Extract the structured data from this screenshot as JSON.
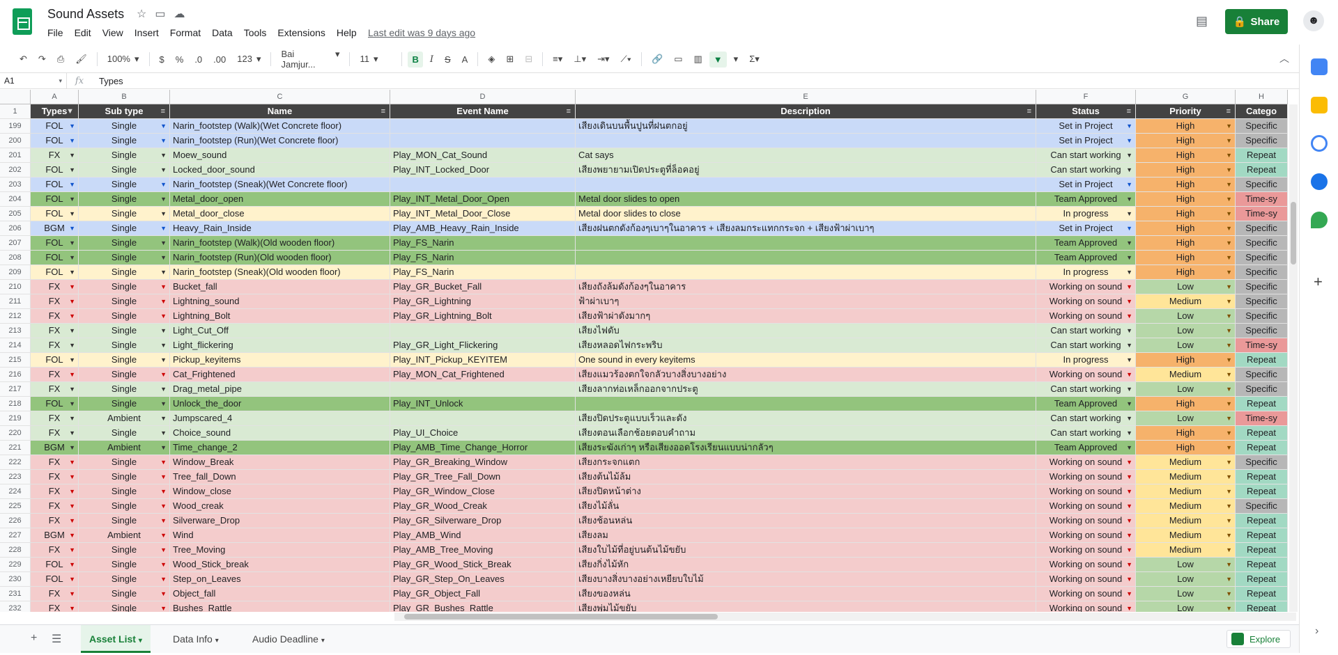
{
  "app": {
    "title": "Sound Assets",
    "menu": [
      "File",
      "Edit",
      "View",
      "Insert",
      "Format",
      "Data",
      "Tools",
      "Extensions",
      "Help"
    ],
    "last_edit": "Last edit was 9 days ago",
    "share_label": "Share"
  },
  "toolbar": {
    "zoom": "100%",
    "currency": "$",
    "percent": "%",
    "dec_less": ".0",
    "dec_more": ".00",
    "number_format": "123",
    "font": "Bai Jamjur...",
    "font_size": "11"
  },
  "formula_bar": {
    "cell_ref": "A1",
    "value": "Types"
  },
  "columns": [
    "A",
    "B",
    "C",
    "D",
    "E",
    "F",
    "G",
    "H"
  ],
  "headers": [
    "Types",
    "Sub type",
    "Name",
    "Event Name",
    "Description",
    "Status",
    "Priority",
    "Catego"
  ],
  "rows": [
    {
      "num": "199",
      "type": "FOL",
      "sub": "Single",
      "name": "Narin_footstep (Walk)(Wet Concrete floor)",
      "event": "",
      "desc": "เสียงเดินบนพื้นปูนที่ฝนตกอยู่",
      "status": "Set in Project",
      "priority": "High",
      "category": "Specific"
    },
    {
      "num": "200",
      "type": "FOL",
      "sub": "Single",
      "name": "Narin_footstep (Run)(Wet Concrete floor)",
      "event": "",
      "desc": "",
      "status": "Set in Project",
      "priority": "High",
      "category": "Specific"
    },
    {
      "num": "201",
      "type": "FX",
      "sub": "Single",
      "name": "Moew_sound",
      "event": "Play_MON_Cat_Sound",
      "desc": "Cat says",
      "status": "Can start working",
      "priority": "High",
      "category": "Repeat"
    },
    {
      "num": "202",
      "type": "FOL",
      "sub": "Single",
      "name": "Locked_door_sound",
      "event": "Play_INT_Locked_Door",
      "desc": "เสียงพยายามเปิดประตูที่ล็อคอยู่",
      "status": "Can start working",
      "priority": "High",
      "category": "Repeat"
    },
    {
      "num": "203",
      "type": "FOL",
      "sub": "Single",
      "name": "Narin_footstep (Sneak)(Wet Concrete floor)",
      "event": "",
      "desc": "",
      "status": "Set in Project",
      "priority": "High",
      "category": "Specific"
    },
    {
      "num": "204",
      "type": "FOL",
      "sub": "Single",
      "name": "Metal_door_open",
      "event": "Play_INT_Metal_Door_Open",
      "desc": "Metal door slides to open",
      "status": "Team Approved",
      "priority": "High",
      "category": "Time-sy"
    },
    {
      "num": "205",
      "type": "FOL",
      "sub": "Single",
      "name": "Metal_door_close",
      "event": "Play_INT_Metal_Door_Close",
      "desc": "Metal door slides to close",
      "status": "In progress",
      "priority": "High",
      "category": "Time-sy"
    },
    {
      "num": "206",
      "type": "BGM",
      "sub": "Single",
      "name": "Heavy_Rain_Inside",
      "event": "Play_AMB_Heavy_Rain_Inside",
      "desc": "เสียงฝนตกดังก้องๆเบาๆในอาคาร + เสียงลมกระแทกกระจก + เสียงฟ้าผ่าเบาๆ",
      "status": "Set in Project",
      "priority": "High",
      "category": "Specific"
    },
    {
      "num": "207",
      "type": "FOL",
      "sub": "Single",
      "name": "Narin_footstep (Walk)(Old wooden floor)",
      "event": "Play_FS_Narin",
      "desc": "",
      "status": "Team Approved",
      "priority": "High",
      "category": "Specific"
    },
    {
      "num": "208",
      "type": "FOL",
      "sub": "Single",
      "name": "Narin_footstep (Run)(Old wooden floor)",
      "event": "Play_FS_Narin",
      "desc": "",
      "status": "Team Approved",
      "priority": "High",
      "category": "Specific"
    },
    {
      "num": "209",
      "type": "FOL",
      "sub": "Single",
      "name": "Narin_footstep (Sneak)(Old wooden floor)",
      "event": "Play_FS_Narin",
      "desc": "",
      "status": "In progress",
      "priority": "High",
      "category": "Specific"
    },
    {
      "num": "210",
      "type": "FX",
      "sub": "Single",
      "name": "Bucket_fall",
      "event": "Play_GR_Bucket_Fall",
      "desc": "เสียงถังล้มดังก้องๆในอาคาร",
      "status": "Working on sound",
      "priority": "Low",
      "category": "Specific"
    },
    {
      "num": "211",
      "type": "FX",
      "sub": "Single",
      "name": "Lightning_sound",
      "event": "Play_GR_Lightning",
      "desc": "ฟ้าผ่าเบาๆ",
      "status": "Working on sound",
      "priority": "Medium",
      "category": "Specific"
    },
    {
      "num": "212",
      "type": "FX",
      "sub": "Single",
      "name": "Lightning_Bolt",
      "event": "Play_GR_Lightning_Bolt",
      "desc": "เสียงฟ้าผ่าดังมากๆ",
      "status": "Working on sound",
      "priority": "Low",
      "category": "Specific"
    },
    {
      "num": "213",
      "type": "FX",
      "sub": "Single",
      "name": "Light_Cut_Off",
      "event": "",
      "desc": "เสียงไฟดับ",
      "status": "Can start working",
      "priority": "Low",
      "category": "Specific"
    },
    {
      "num": "214",
      "type": "FX",
      "sub": "Single",
      "name": "Light_flickering",
      "event": "Play_GR_Light_Flickering",
      "desc": "เสียงหลอดไฟกระพริบ",
      "status": "Can start working",
      "priority": "Low",
      "category": "Time-sy"
    },
    {
      "num": "215",
      "type": "FOL",
      "sub": "Single",
      "name": "Pickup_keyitems",
      "event": "Play_INT_Pickup_KEYITEM",
      "desc": "One sound in every keyitems",
      "status": "In progress",
      "priority": "High",
      "category": "Repeat"
    },
    {
      "num": "216",
      "type": "FX",
      "sub": "Single",
      "name": "Cat_Frightened",
      "event": "Play_MON_Cat_Frightened",
      "desc": "เสียงแมวร้องตกใจกลัวบางสิ่งบางอย่าง",
      "status": "Working on sound",
      "priority": "Medium",
      "category": "Specific"
    },
    {
      "num": "217",
      "type": "FX",
      "sub": "Single",
      "name": "Drag_metal_pipe",
      "event": "",
      "desc": "เสียงลากท่อเหล็กออกจากประตู",
      "status": "Can start working",
      "priority": "Low",
      "category": "Specific"
    },
    {
      "num": "218",
      "type": "FOL",
      "sub": "Single",
      "name": "Unlock_the_door",
      "event": "Play_INT_Unlock",
      "desc": "",
      "status": "Team Approved",
      "priority": "High",
      "category": "Repeat"
    },
    {
      "num": "219",
      "type": "FX",
      "sub": "Ambient",
      "name": "Jumpscared_4",
      "event": "",
      "desc": "เสียงปิดประตูแบบเร็วและดัง",
      "status": "Can start working",
      "priority": "Low",
      "category": "Time-sy"
    },
    {
      "num": "220",
      "type": "FX",
      "sub": "Single",
      "name": "Choice_sound",
      "event": "Play_UI_Choice",
      "desc": "เสียงตอนเลือกช้อยตอบคำถาม",
      "status": "Can start working",
      "priority": "High",
      "category": "Repeat"
    },
    {
      "num": "221",
      "type": "BGM",
      "sub": "Ambient",
      "name": "Time_change_2",
      "event": "Play_AMB_Time_Change_Horror",
      "desc": "เสียงระฆังเก่าๆ หรือเสียงออดโรงเรียนแบบน่ากลัวๆ",
      "status": "Team Approved",
      "priority": "High",
      "category": "Repeat"
    },
    {
      "num": "222",
      "type": "FX",
      "sub": "Single",
      "name": "Window_Break",
      "event": "Play_GR_Breaking_Window",
      "desc": "เสียงกระจกแตก",
      "status": "Working on sound",
      "priority": "Medium",
      "category": "Specific"
    },
    {
      "num": "223",
      "type": "FX",
      "sub": "Single",
      "name": "Tree_fall_Down",
      "event": "Play_GR_Tree_Fall_Down",
      "desc": "เสียงต้นไม้ล้ม",
      "status": "Working on sound",
      "priority": "Medium",
      "category": "Repeat"
    },
    {
      "num": "224",
      "type": "FX",
      "sub": "Single",
      "name": "Window_close",
      "event": "Play_GR_Window_Close",
      "desc": "เสียงปิดหน้าต่าง",
      "status": "Working on sound",
      "priority": "Medium",
      "category": "Repeat"
    },
    {
      "num": "225",
      "type": "FX",
      "sub": "Single",
      "name": "Wood_creak",
      "event": "Play_GR_Wood_Creak",
      "desc": "เสียงไม้ลั่น",
      "status": "Working on sound",
      "priority": "Medium",
      "category": "Specific"
    },
    {
      "num": "226",
      "type": "FX",
      "sub": "Single",
      "name": "Silverware_Drop",
      "event": "Play_GR_Silverware_Drop",
      "desc": "เสียงช้อนหล่น",
      "status": "Working on sound",
      "priority": "Medium",
      "category": "Repeat"
    },
    {
      "num": "227",
      "type": "BGM",
      "sub": "Ambient",
      "name": "Wind",
      "event": "Play_AMB_Wind",
      "desc": "เสียงลม",
      "status": "Working on sound",
      "priority": "Medium",
      "category": "Repeat"
    },
    {
      "num": "228",
      "type": "FX",
      "sub": "Single",
      "name": "Tree_Moving",
      "event": "Play_AMB_Tree_Moving",
      "desc": "เสียงใบไม้ที่อยู่บนต้นไม้ขยับ",
      "status": "Working on sound",
      "priority": "Medium",
      "category": "Repeat"
    },
    {
      "num": "229",
      "type": "FOL",
      "sub": "Single",
      "name": "Wood_Stick_break",
      "event": "Play_GR_Wood_Stick_Break",
      "desc": "เสียงกิ่งไม้หัก",
      "status": "Working on sound",
      "priority": "Low",
      "category": "Repeat"
    },
    {
      "num": "230",
      "type": "FOL",
      "sub": "Single",
      "name": "Step_on_Leaves",
      "event": "Play_GR_Step_On_Leaves",
      "desc": "เสียงบางสิ่งบางอย่างเหยียบใบไม้",
      "status": "Working on sound",
      "priority": "Low",
      "category": "Repeat"
    },
    {
      "num": "231",
      "type": "FX",
      "sub": "Single",
      "name": "Object_fall",
      "event": "Play_GR_Object_Fall",
      "desc": "เสียงของหล่น",
      "status": "Working on sound",
      "priority": "Low",
      "category": "Repeat"
    },
    {
      "num": "232",
      "type": "FX",
      "sub": "Single",
      "name": "Bushes_Rattle",
      "event": "Play_GR_Bushes_Rattle",
      "desc": "เสียงพุ่มไม้ขยับ",
      "status": "Working on sound",
      "priority": "Low",
      "category": "Repeat"
    }
  ],
  "status_colors": {
    "Set in Project": "#c9daf8",
    "Can start working": "#d9ead3",
    "Team Approved": "#93c47d",
    "In progress": "#fff2cc",
    "Working on sound": "#f4cccc"
  },
  "priority_colors": {
    "High": "#f6b26b",
    "Medium": "#ffe599",
    "Low": "#b6d7a8"
  },
  "category_colors": {
    "Specific": "#b7b7b7",
    "Repeat": "#a2d9c3",
    "Time-sy": "#ea9999"
  },
  "sheets": [
    "Asset List",
    "Data Info",
    "Audio Deadline"
  ],
  "explore_label": "Explore"
}
